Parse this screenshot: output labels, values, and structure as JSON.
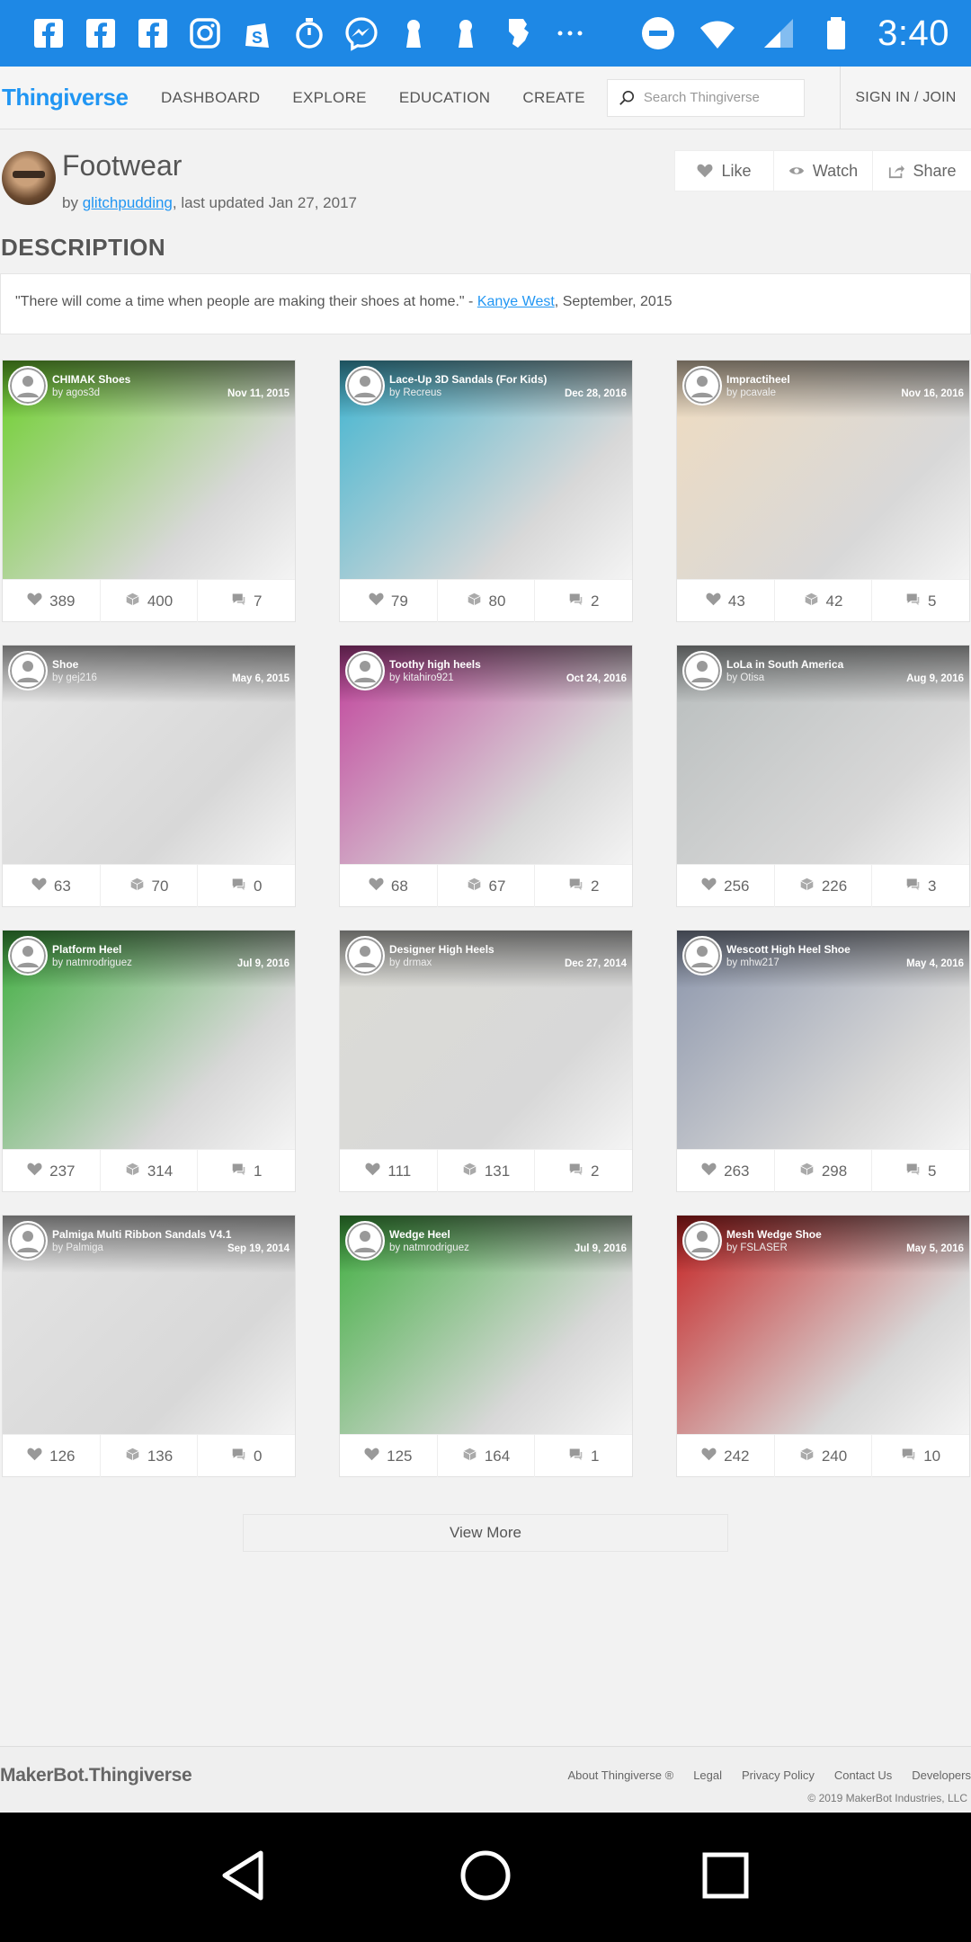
{
  "status_bar": {
    "time": "3:40",
    "icons": [
      "facebook-icon",
      "facebook-icon",
      "facebook-icon",
      "instagram-icon",
      "shopify-icon",
      "stopwatch-icon",
      "messenger-icon",
      "keyhole-icon",
      "keyhole-icon",
      "map-icon",
      "more-dots-icon",
      "do-not-disturb-icon",
      "wifi-icon",
      "signal-icon",
      "battery-icon"
    ]
  },
  "nav": {
    "logo": "Thingiverse",
    "links": [
      "DASHBOARD",
      "EXPLORE",
      "EDUCATION",
      "CREATE"
    ],
    "search_placeholder": "Search Thingiverse",
    "signin": "SIGN IN / JOIN"
  },
  "thing": {
    "title": "Footwear",
    "by_prefix": "by ",
    "author": "glitchpudding",
    "updated": ", last updated Jan 27, 2017",
    "like_label": "Like",
    "watch_label": "Watch",
    "share_label": "Share"
  },
  "description": {
    "heading": "DESCRIPTION",
    "quote": "\"There will come a time when people are making their shoes at home.\" - ",
    "quote_author": "Kanye West",
    "quote_suffix": ", September, 2015"
  },
  "cards": [
    {
      "title": "CHIMAK Shoes",
      "by": "by agos3d",
      "date": "Nov 11, 2015",
      "likes": "389",
      "collects": "400",
      "comments": "7",
      "color": "#6ccf2a"
    },
    {
      "title": "Lace-Up 3D Sandals (For Kids)",
      "by": "by Recreus",
      "date": "Dec 28, 2016",
      "likes": "79",
      "collects": "80",
      "comments": "2",
      "color": "#3fb4d0"
    },
    {
      "title": "Impractiheel",
      "by": "by pcavale",
      "date": "Nov 16, 2016",
      "likes": "43",
      "collects": "42",
      "comments": "5",
      "color": "#f0dcc0"
    },
    {
      "title": "Shoe",
      "by": "by gej216",
      "date": "May 6, 2015",
      "likes": "63",
      "collects": "70",
      "comments": "0",
      "color": "#e8e8e8"
    },
    {
      "title": "Toothy high heels",
      "by": "by kitahiro921",
      "date": "Oct 24, 2016",
      "likes": "68",
      "collects": "67",
      "comments": "2",
      "color": "#c0409a"
    },
    {
      "title": "LoLa in South America",
      "by": "by Otisa",
      "date": "Aug 9, 2016",
      "likes": "256",
      "collects": "226",
      "comments": "3",
      "color": "#b8bdbd"
    },
    {
      "title": "Platform Heel",
      "by": "by natmrodriguez",
      "date": "Jul 9, 2016",
      "likes": "237",
      "collects": "314",
      "comments": "1",
      "color": "#3fae3f"
    },
    {
      "title": "Designer High Heels",
      "by": "by drmax",
      "date": "Dec 27, 2014",
      "likes": "111",
      "collects": "131",
      "comments": "2",
      "color": "#dcdcd6"
    },
    {
      "title": "Wescott High Heel Shoe",
      "by": "by mhw217",
      "date": "May 4, 2016",
      "likes": "263",
      "collects": "298",
      "comments": "5",
      "color": "#8a94aa"
    },
    {
      "title": "Palmiga Multi Ribbon Sandals V4.1",
      "by": "by Palmiga",
      "date": "Sep 19, 2014",
      "likes": "126",
      "collects": "136",
      "comments": "0",
      "color": "#e4e4e4"
    },
    {
      "title": "Wedge Heel",
      "by": "by natmrodriguez",
      "date": "Jul 9, 2016",
      "likes": "125",
      "collects": "164",
      "comments": "1",
      "color": "#3fae3f"
    },
    {
      "title": "Mesh Wedge Shoe",
      "by": "by FSLASER",
      "date": "May 5, 2016",
      "likes": "242",
      "collects": "240",
      "comments": "10",
      "color": "#c42020"
    }
  ],
  "view_more": "View More",
  "footer": {
    "logo": "MakerBot.Thingiverse",
    "links": [
      "About Thingiverse ®",
      "Legal",
      "Privacy Policy",
      "Contact Us",
      "Developers"
    ],
    "copyright": "© 2019 MakerBot Industries, LLC"
  },
  "colors": {
    "status_bar": "#1e88e5",
    "accent": "#2196f3"
  }
}
